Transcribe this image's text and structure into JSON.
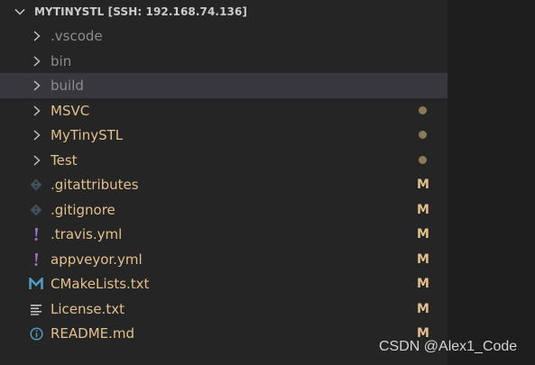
{
  "explorer": {
    "title": "MYTINYSTL [SSH: 192.168.74.136]",
    "items": [
      {
        "label": ".vscode",
        "kind": "folder",
        "icon": "chevron-right-icon",
        "status": ""
      },
      {
        "label": "bin",
        "kind": "folder",
        "icon": "chevron-right-icon",
        "status": ""
      },
      {
        "label": "build",
        "kind": "folder",
        "icon": "chevron-right-icon",
        "status": "",
        "selected": true
      },
      {
        "label": "MSVC",
        "kind": "folder",
        "icon": "chevron-right-icon",
        "status": "modified-dot"
      },
      {
        "label": "MyTinySTL",
        "kind": "folder",
        "icon": "chevron-right-icon",
        "status": "modified-dot"
      },
      {
        "label": "Test",
        "kind": "folder",
        "icon": "chevron-right-icon",
        "status": "modified-dot"
      },
      {
        "label": ".gitattributes",
        "kind": "file",
        "icon": "git-icon",
        "status": "M"
      },
      {
        "label": ".gitignore",
        "kind": "file",
        "icon": "git-icon",
        "status": "M"
      },
      {
        "label": ".travis.yml",
        "kind": "file",
        "icon": "yaml-icon",
        "status": "M"
      },
      {
        "label": "appveyor.yml",
        "kind": "file",
        "icon": "yaml-icon",
        "status": "M"
      },
      {
        "label": "CMakeLists.txt",
        "kind": "file",
        "icon": "cmake-icon",
        "status": "M"
      },
      {
        "label": "License.txt",
        "kind": "file",
        "icon": "text-file-icon",
        "status": "M"
      },
      {
        "label": "README.md",
        "kind": "file",
        "icon": "info-icon",
        "status": "M"
      }
    ]
  },
  "watermark": "CSDN @Alex1_Code",
  "colors": {
    "background": "#1e1e1e",
    "panel": "#252526",
    "selected_row": "#37373d",
    "modified_text": "#e2c08d",
    "dim_text": "#8c8c8c",
    "yaml_icon": "#a074c4",
    "cmake_icon": "#519aba",
    "git_icon": "#41535b",
    "info_icon": "#519aba"
  }
}
